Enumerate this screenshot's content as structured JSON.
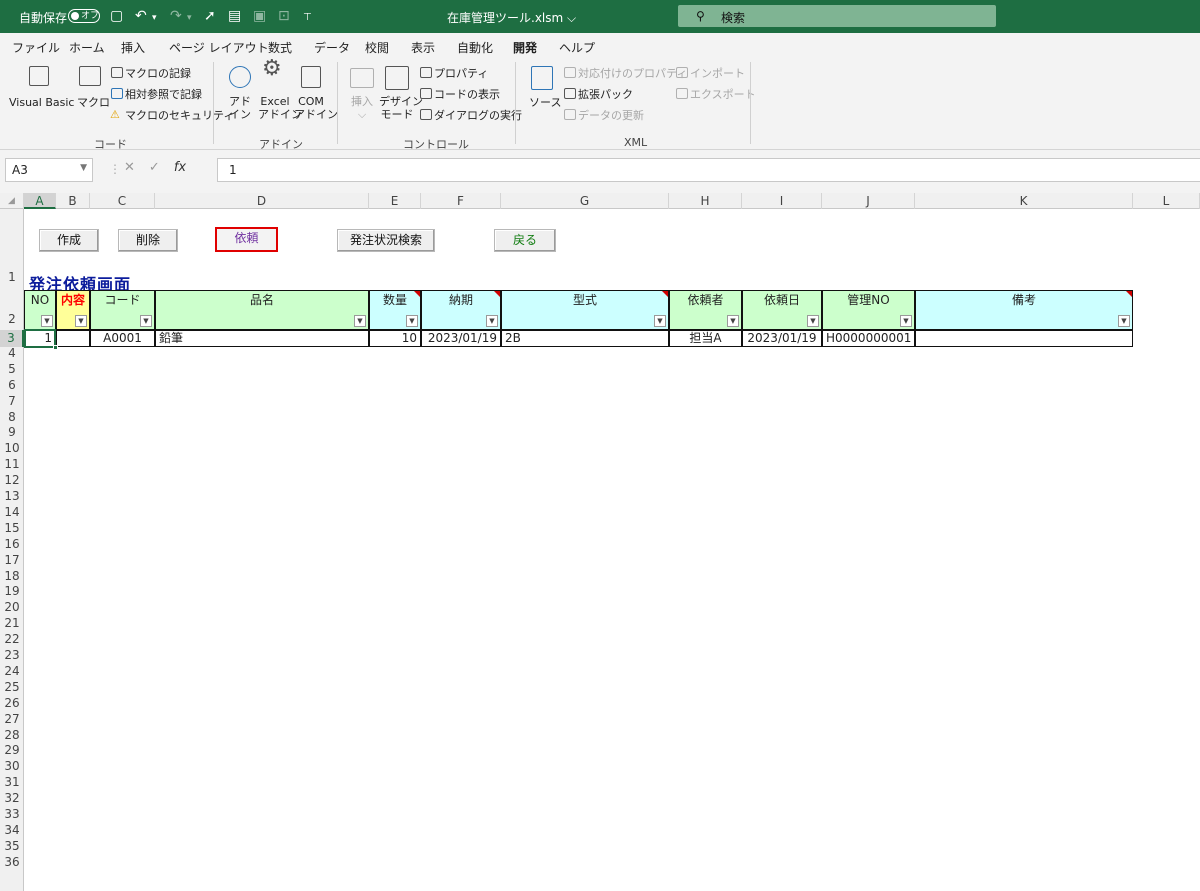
{
  "titlebar": {
    "autosave_label": "自動保存",
    "autosave_state": "オフ",
    "filename": "在庫管理ツール.xlsm",
    "search_placeholder": "検索",
    "background": "#1e6e42"
  },
  "tabs": [
    "ファイル",
    "ホーム",
    "挿入",
    "ページ レイアウト",
    "数式",
    "データ",
    "校閲",
    "表示",
    "自動化",
    "開発",
    "ヘルプ"
  ],
  "active_tab": "開発",
  "ribbon": {
    "code": {
      "group": "コード",
      "visual_basic": "Visual Basic",
      "macro": "マクロ",
      "record_macro": "マクロの記録",
      "relative_ref": "相対参照で記録",
      "macro_security": "マクロのセキュリティ"
    },
    "addins": {
      "group": "アドイン",
      "addin_1": "アド",
      "addin_2": "イン",
      "excel_addin_1": "Excel",
      "excel_addin_2": "アドイン",
      "com_addin_1": "COM",
      "com_addin_2": "アドイン"
    },
    "controls": {
      "group": "コントロール",
      "insert": "挿入",
      "design_1": "デザイン",
      "design_2": "モード",
      "properties": "プロパティ",
      "view_code": "コードの表示",
      "run_dialog": "ダイアログの実行"
    },
    "xml": {
      "group": "XML",
      "source": "ソース",
      "map_props": "対応付けのプロパティ",
      "expansion_packs": "拡張パック",
      "refresh_data": "データの更新",
      "import": "インポート",
      "export": "エクスポート"
    }
  },
  "formula_bar": {
    "name_box": "A3",
    "formula": "1"
  },
  "columns": [
    "A",
    "B",
    "C",
    "D",
    "E",
    "F",
    "G",
    "H",
    "I",
    "J",
    "K",
    "L"
  ],
  "selected_column": "A",
  "rows": [
    "1",
    "2",
    "3",
    "4",
    "5",
    "6",
    "7",
    "8",
    "9",
    "10",
    "11",
    "12",
    "13",
    "14",
    "15",
    "16",
    "17",
    "18",
    "19",
    "20",
    "21",
    "22",
    "23",
    "24",
    "25",
    "26",
    "27",
    "28",
    "29",
    "30",
    "31",
    "32",
    "33",
    "34",
    "35",
    "36"
  ],
  "selected_row": "3",
  "sheet": {
    "title": "発注依頼画面",
    "buttons": {
      "create": "作成",
      "delete": "削除",
      "request": "依頼",
      "search": "発注状況検索",
      "back": "戻る"
    },
    "headers": [
      "NO",
      "内容",
      "コード",
      "品名",
      "数量",
      "納期",
      "型式",
      "依頼者",
      "依頼日",
      "管理NO",
      "備考"
    ],
    "filter_glyph": "▼",
    "row": [
      "1",
      "",
      "A0001",
      "鉛筆",
      "10",
      "2023/01/19",
      "2B",
      "担当A",
      "2023/01/19",
      "H0000000001",
      ""
    ],
    "colors": {
      "title": "#0c1c9c",
      "header_green": "#ccffcc",
      "header_cyan": "#ccffff",
      "header_yellow": "#ffff99",
      "naiyo_text": "#ff0000",
      "request_border": "#e00000",
      "back_text": "#107c10"
    }
  }
}
